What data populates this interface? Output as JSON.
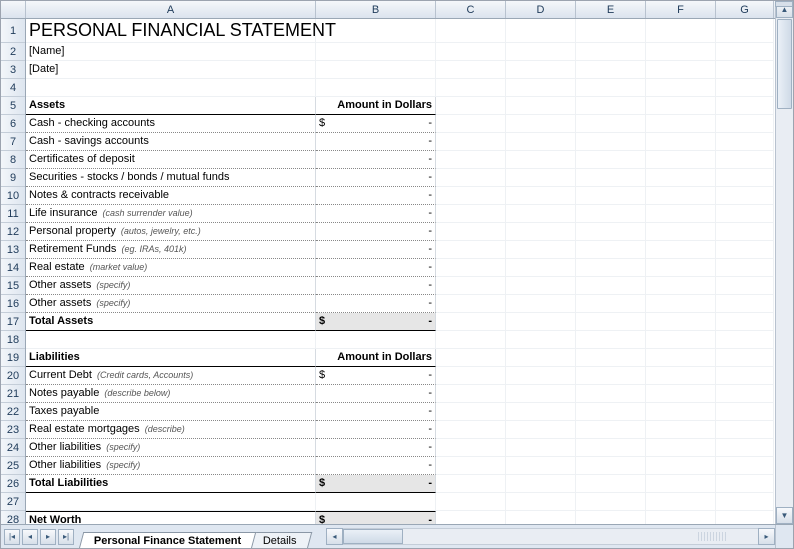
{
  "columns": [
    "A",
    "B",
    "C",
    "D",
    "E",
    "F",
    "G"
  ],
  "title": "PERSONAL FINANCIAL STATEMENT",
  "name_placeholder": "[Name]",
  "date_placeholder": "[Date]",
  "assets": {
    "header": "Assets",
    "amount_header": "Amount in Dollars",
    "items": [
      {
        "label": "Cash - checking accounts",
        "note": "",
        "value": "$                          -"
      },
      {
        "label": "Cash - savings accounts",
        "note": "",
        "value": "-"
      },
      {
        "label": "Certificates of deposit",
        "note": "",
        "value": "-"
      },
      {
        "label": "Securities - stocks / bonds / mutual funds",
        "note": "",
        "value": "-"
      },
      {
        "label": "Notes & contracts receivable",
        "note": "",
        "value": "-"
      },
      {
        "label": "Life insurance",
        "note": "(cash surrender value)",
        "value": "-"
      },
      {
        "label": "Personal property",
        "note": "(autos, jewelry, etc.)",
        "value": "-"
      },
      {
        "label": "Retirement Funds",
        "note": "(eg. IRAs, 401k)",
        "value": "-"
      },
      {
        "label": "Real estate",
        "note": "(market value)",
        "value": "-"
      },
      {
        "label": "Other assets",
        "note": "(specify)",
        "value": "-"
      },
      {
        "label": "Other assets",
        "note": "(specify)",
        "value": "-"
      }
    ],
    "total_label": "Total Assets",
    "total_value": "$                          -"
  },
  "liabilities": {
    "header": "Liabilities",
    "amount_header": "Amount in Dollars",
    "items": [
      {
        "label": "Current Debt",
        "note": "(Credit cards, Accounts)",
        "value": "$                          -"
      },
      {
        "label": "Notes payable",
        "note": "(describe below)",
        "value": "-"
      },
      {
        "label": "Taxes payable",
        "note": "",
        "value": "-"
      },
      {
        "label": "Real estate mortgages",
        "note": "(describe)",
        "value": "-"
      },
      {
        "label": "Other liabilities",
        "note": "(specify)",
        "value": "-"
      },
      {
        "label": "Other liabilities",
        "note": "(specify)",
        "value": "-"
      }
    ],
    "total_label": "Total Liabilities",
    "total_value": "$                          -"
  },
  "networth": {
    "label": "Net Worth",
    "value": "$                          -"
  },
  "tabs": {
    "active": "Personal Finance Statement",
    "other": "Details"
  },
  "row_numbers": [
    1,
    2,
    3,
    4,
    5,
    6,
    7,
    8,
    9,
    10,
    11,
    12,
    13,
    14,
    15,
    16,
    17,
    18,
    19,
    20,
    21,
    22,
    23,
    24,
    25,
    26,
    27,
    28
  ]
}
